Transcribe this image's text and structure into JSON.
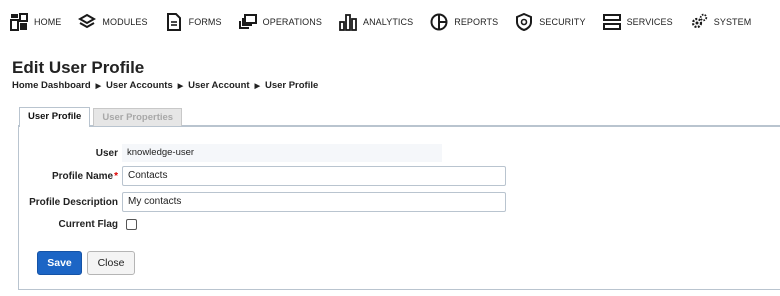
{
  "nav": {
    "items": [
      {
        "label": "HOME",
        "icon": "home-grid-icon"
      },
      {
        "label": "MODULES",
        "icon": "modules-chevrons-icon"
      },
      {
        "label": "FORMS",
        "icon": "forms-document-icon"
      },
      {
        "label": "OPERATIONS",
        "icon": "operations-stacked-windows-icon"
      },
      {
        "label": "ANALYTICS",
        "icon": "analytics-bar-chart-icon"
      },
      {
        "label": "REPORTS",
        "icon": "reports-pie-chart-icon"
      },
      {
        "label": "SECURITY",
        "icon": "security-shield-icon"
      },
      {
        "label": "SERVICES",
        "icon": "services-server-icon"
      },
      {
        "label": "SYSTEM",
        "icon": "system-gears-icon"
      }
    ]
  },
  "page": {
    "title": "Edit User Profile",
    "breadcrumb": [
      "Home Dashboard",
      "User Accounts",
      "User Account",
      "User Profile"
    ]
  },
  "tabs": [
    {
      "label": "User Profile",
      "active": true
    },
    {
      "label": "User Properties",
      "active": false
    }
  ],
  "form": {
    "user_label": "User",
    "user_value": "knowledge-user",
    "profile_name_label": "Profile Name",
    "profile_name_value": "Contacts",
    "profile_description_label": "Profile Description",
    "profile_description_value": "My contacts",
    "current_flag_label": "Current Flag",
    "current_flag_checked": false,
    "required_marker": "*"
  },
  "buttons": {
    "save": "Save",
    "close": "Close"
  },
  "colors": {
    "primary_button": "#1c65c5",
    "required": "#dd0000",
    "border": "#b9c4cf"
  }
}
